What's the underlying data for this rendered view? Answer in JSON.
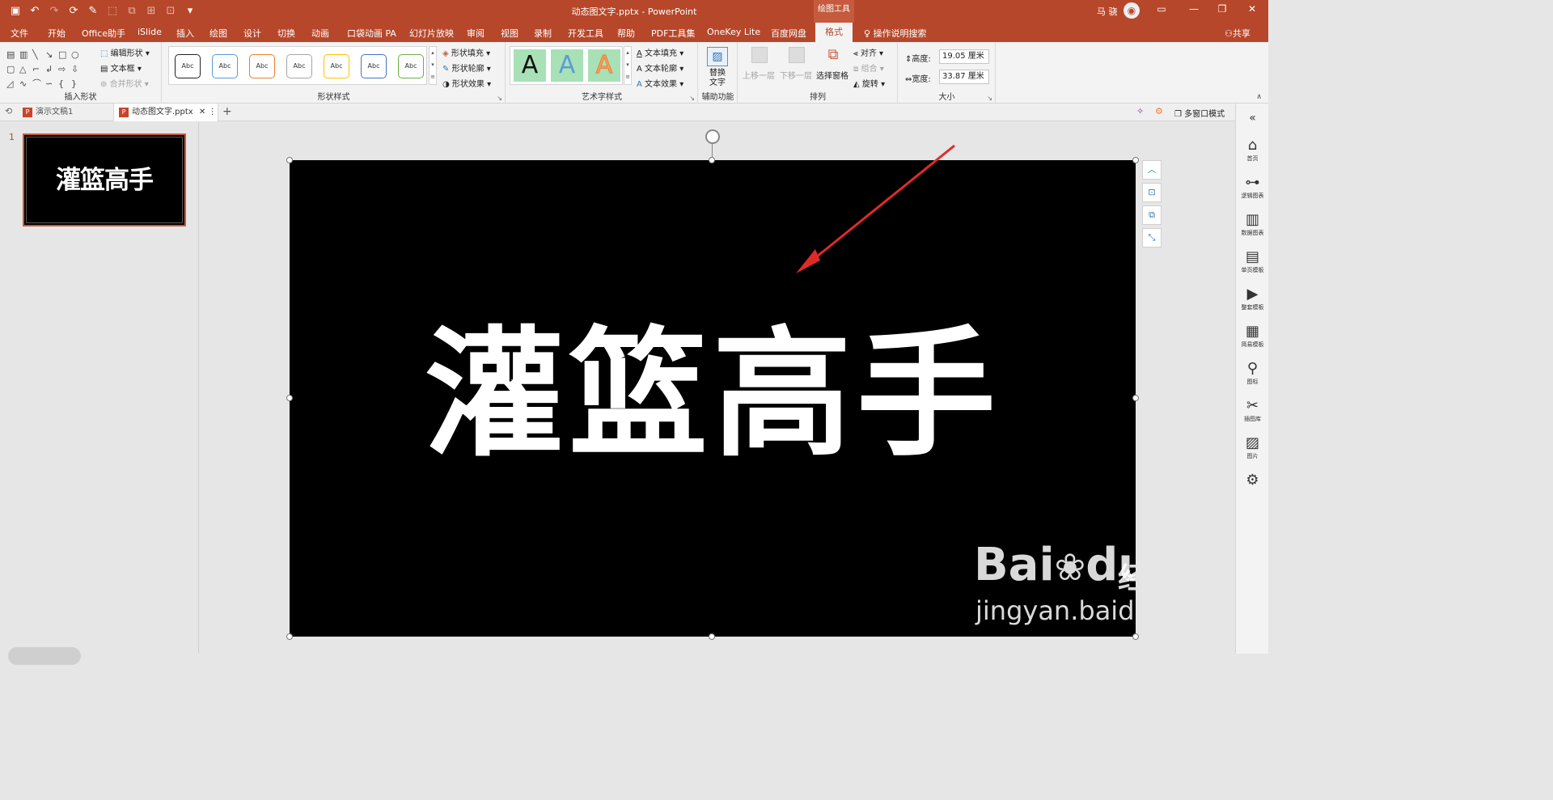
{
  "titlebar": {
    "document": "动态图文字.pptx",
    "separator": "-",
    "app": "PowerPoint",
    "context_tool": "绘图工具",
    "user": "马 骁",
    "colors": {
      "accent": "#b7472a"
    }
  },
  "qat_icons": [
    "save-icon",
    "undo-icon",
    "redo-icon",
    "repeat-icon",
    "format-painter-icon",
    "shape-icon",
    "group-icon",
    "arrange-icon",
    "selection-icon",
    "customize-icon"
  ],
  "tabs": [
    "文件",
    "开始",
    "Office助手",
    "iSlide",
    "插入",
    "绘图",
    "设计",
    "切换",
    "动画",
    "口袋动画 PA",
    "幻灯片放映",
    "审阅",
    "视图",
    "录制",
    "开发工具",
    "帮助",
    "PDF工具集",
    "OneKey Lite",
    "百度网盘",
    "格式",
    "操作说明搜索",
    "共享"
  ],
  "active_tab": "格式",
  "ribbon": {
    "insert_shapes": {
      "label": "插入形状",
      "edit_shape": "编辑形状",
      "text_box": "文本框",
      "merge_shapes": "合并形状"
    },
    "shape_styles": {
      "label": "形状样式",
      "sample": "Abc",
      "fill": "形状填充",
      "outline": "形状轮廓",
      "effect": "形状效果",
      "border_colors": [
        "#222222",
        "#5b9bd5",
        "#ed7d31",
        "#a5a5a5",
        "#ffc000",
        "#4472c4",
        "#70ad47"
      ]
    },
    "wordart": {
      "label": "艺术字样式",
      "sample": "A",
      "text_fill": "文本填充",
      "text_outline": "文本轮廓",
      "text_effect": "文本效果"
    },
    "accessibility": {
      "label": "辅助功能",
      "alt_text_1": "替换",
      "alt_text_2": "文字"
    },
    "arrange": {
      "label": "排列",
      "bring_forward": "上移一层",
      "send_backward": "下移一层",
      "selection_pane": "选择窗格",
      "align": "对齐",
      "group": "组合",
      "rotate": "旋转"
    },
    "size": {
      "label": "大小",
      "height_label": "高度:",
      "height_value": "19.05 厘米",
      "width_label": "宽度:",
      "width_value": "33.87 厘米"
    }
  },
  "doc_tabs": {
    "tab1": "演示文稿1",
    "tab2": "动态图文字.pptx",
    "multi_window": "多窗口模式"
  },
  "slides_pane": {
    "slide_number": "1",
    "thumb_text": "灌篮高手"
  },
  "slide": {
    "text": "灌篮高手"
  },
  "right_panel": [
    {
      "icon": "home-icon",
      "glyph": "⌂",
      "label": "首页"
    },
    {
      "icon": "logic-chart-icon",
      "glyph": "⊶",
      "label": "逻辑图表"
    },
    {
      "icon": "data-chart-icon",
      "glyph": "▥",
      "label": "数据图表"
    },
    {
      "icon": "single-template-icon",
      "glyph": "▤",
      "label": "单页模板"
    },
    {
      "icon": "full-template-icon",
      "glyph": "▶",
      "label": "整套模板"
    },
    {
      "icon": "simple-template-icon",
      "glyph": "▦",
      "label": "简易模板"
    },
    {
      "icon": "icon-library-icon",
      "glyph": "⚲",
      "label": "图标"
    },
    {
      "icon": "illustration-icon",
      "glyph": "✂",
      "label": "插图库"
    },
    {
      "icon": "picture-icon",
      "glyph": "▨",
      "label": "图片"
    },
    {
      "icon": "settings-icon",
      "glyph": "⚙",
      "label": ""
    }
  ],
  "watermark": {
    "brand": "Bai",
    "brand2": "du",
    "suffix": "经验",
    "url": "jingyan.baidu.com"
  }
}
